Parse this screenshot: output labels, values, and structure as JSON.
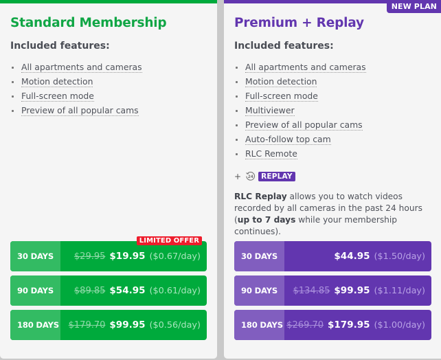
{
  "plans": [
    {
      "title": "Standard Membership",
      "features_heading": "Included features:",
      "features": [
        "All apartments and cameras",
        "Motion detection",
        "Full-screen mode",
        "Preview of all popular cams"
      ],
      "accent_color": "#00aa3c",
      "prices": [
        {
          "days": "30 DAYS",
          "old": "$29.95",
          "new": "$19.95",
          "per_day": "($0.67/day)",
          "badge": "LIMITED OFFER"
        },
        {
          "days": "90 DAYS",
          "old": "$89.85",
          "new": "$54.95",
          "per_day": "($0.61/day)"
        },
        {
          "days": "180 DAYS",
          "old": "$179.70",
          "new": "$99.95",
          "per_day": "($0.56/day)"
        }
      ]
    },
    {
      "title": "Premium + Replay",
      "badge": "NEW PLAN",
      "features_heading": "Included features:",
      "features": [
        "All apartments and cameras",
        "Motion detection",
        "Full-screen mode",
        "Multiviewer",
        "Preview of all popular cams",
        "Auto-follow top cam",
        "RLC Remote"
      ],
      "addon": {
        "plus": "+",
        "icon": "replay-24-icon",
        "icon_text": "24",
        "tag": "REPLAY"
      },
      "description": {
        "bold1": "RLC Replay",
        "text1": " allows you to watch videos recorded by all cameras in the past 24 hours (",
        "bold2": "up to 7 days",
        "text2": " while your membership continues)."
      },
      "accent_color": "#6236af",
      "prices": [
        {
          "days": "30 DAYS",
          "new": "$44.95",
          "per_day": "($1.50/day)"
        },
        {
          "days": "90 DAYS",
          "old": "$134.85",
          "new": "$99.95",
          "per_day": "($1.11/day)"
        },
        {
          "days": "180 DAYS",
          "old": "$269.70",
          "new": "$179.95",
          "per_day": "($1.00/day)"
        }
      ]
    }
  ]
}
